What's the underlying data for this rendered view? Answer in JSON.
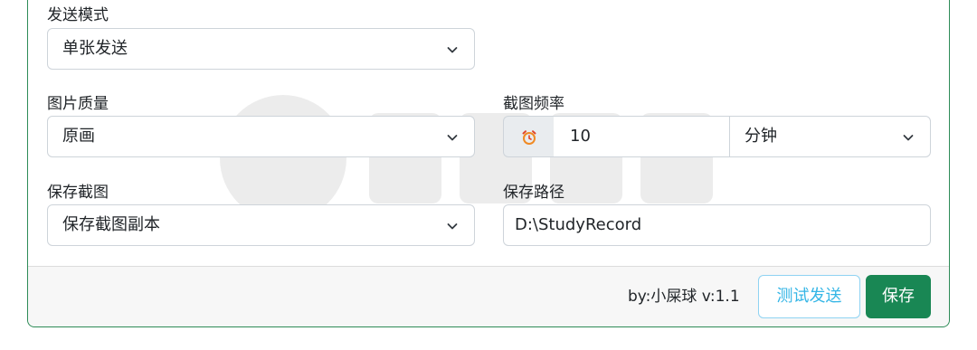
{
  "send_mode": {
    "label": "发送模式",
    "value": "单张发送"
  },
  "image_quality": {
    "label": "图片质量",
    "value": "原画"
  },
  "capture_frequency": {
    "label": "截图频率",
    "value": "10",
    "unit": "分钟"
  },
  "save_capture": {
    "label": "保存截图",
    "value": "保存截图副本"
  },
  "save_path": {
    "label": "保存路径",
    "value": "D:\\StudyRecord"
  },
  "footer": {
    "version": "by:小屎球 v:1.1",
    "test_send": "测试发送",
    "save": "保存"
  },
  "icons": {
    "chevron": "chevron-down-icon",
    "alarm": "alarm-clock-icon"
  },
  "colors": {
    "primary_green": "#198754",
    "info_blue": "#35b6e6",
    "alarm_orange": "#f08a24",
    "card_border": "#2e8b57"
  }
}
